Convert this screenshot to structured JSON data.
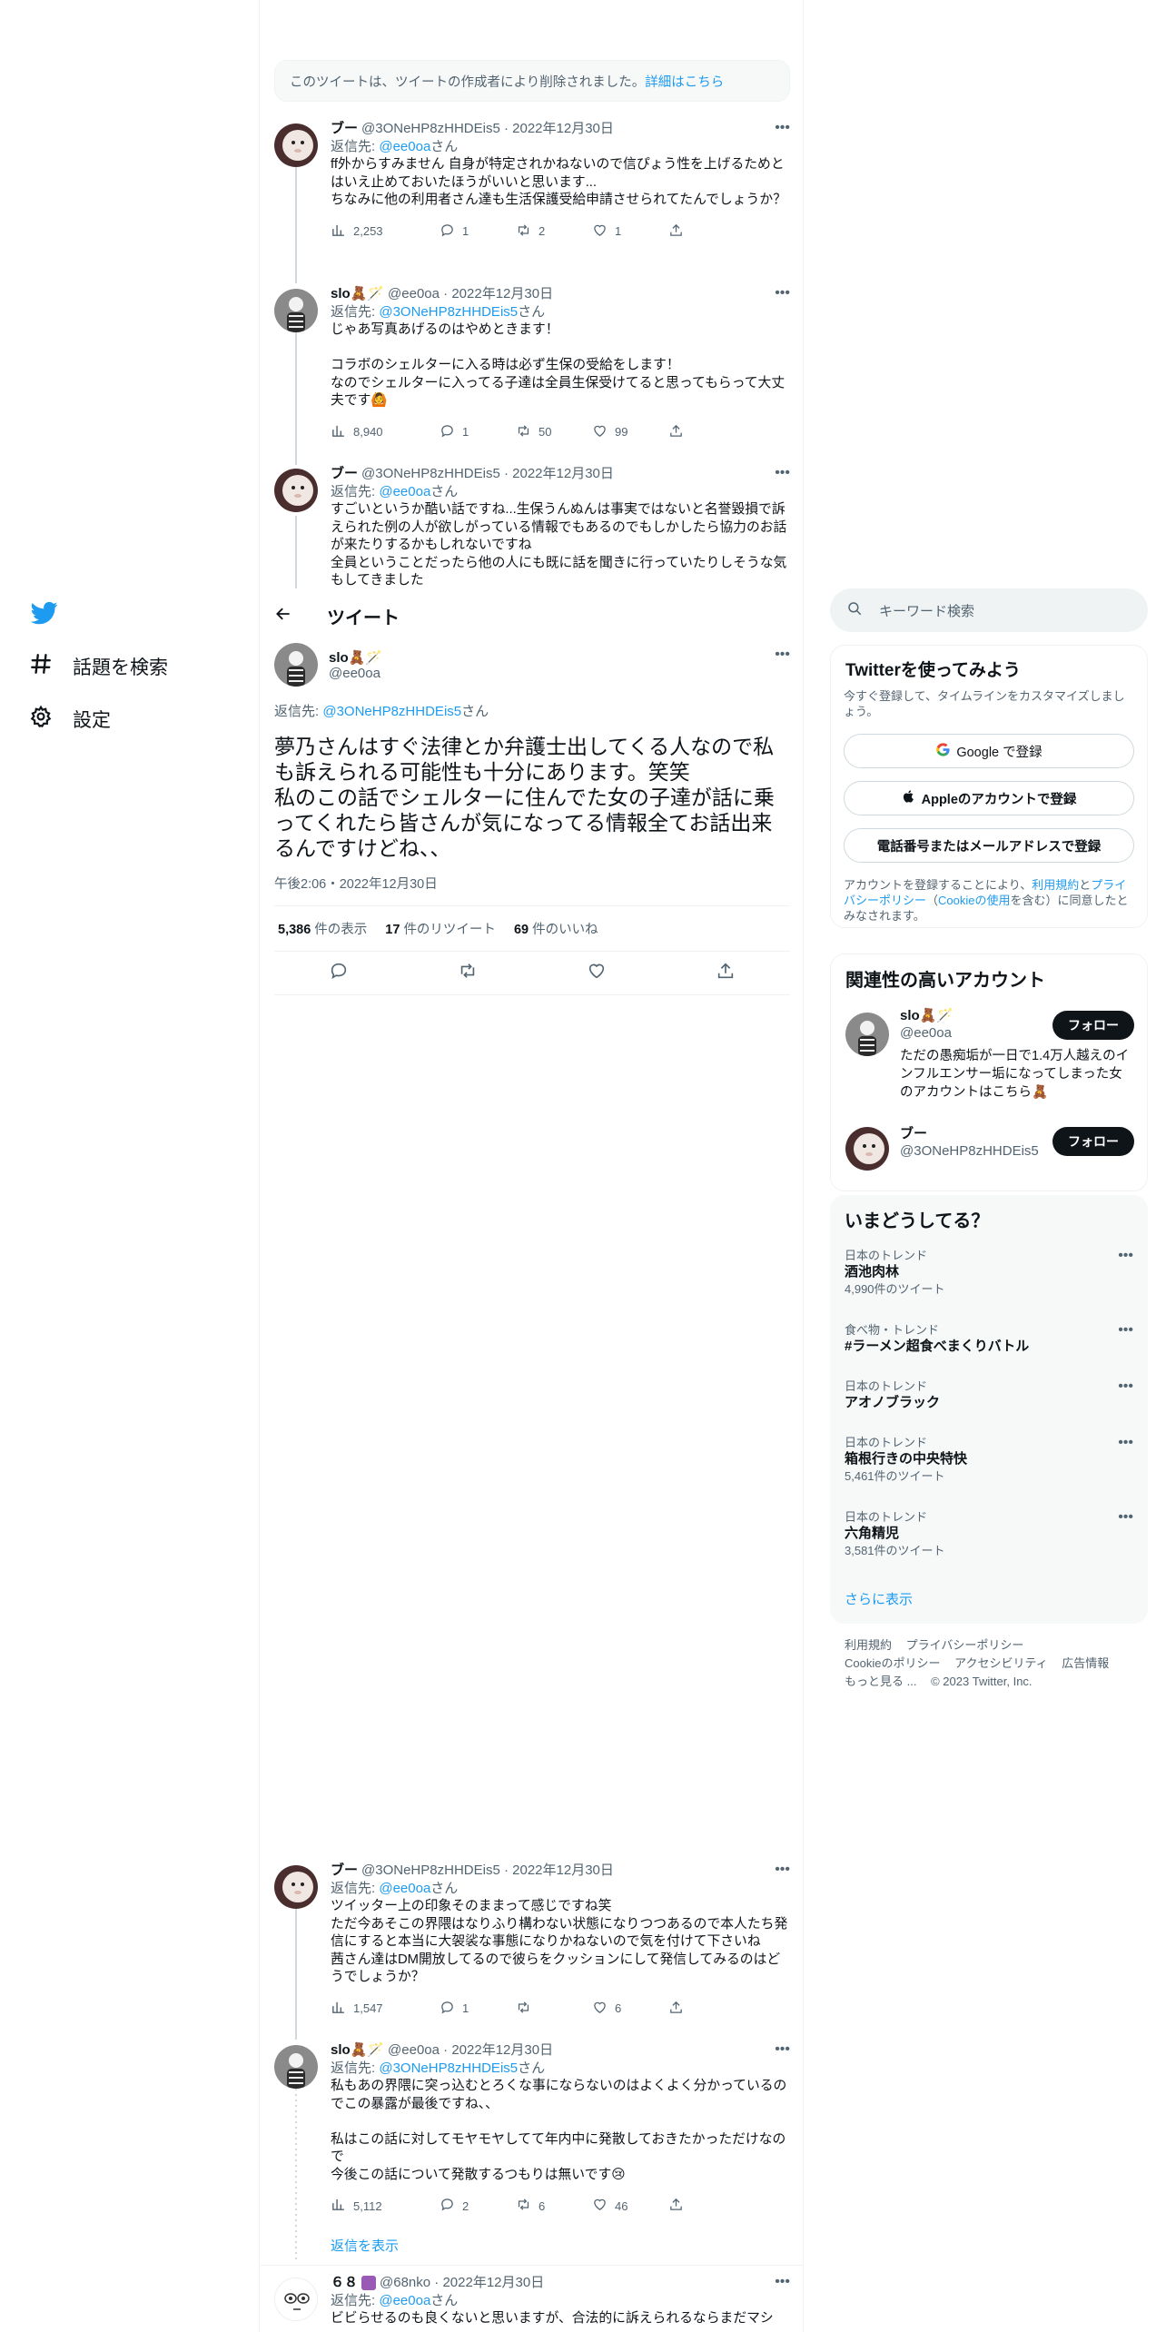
{
  "nav": {
    "explore_label": "話題を検索",
    "settings_label": "設定"
  },
  "deleted_notice": {
    "text": "このツイートは、ツイートの作成者により削除されました。",
    "link": "詳細はこちら"
  },
  "thread_above": [
    {
      "name": "ブー",
      "handle": "@3ONeHP8zHHDEis5",
      "date": "2022年12月30日",
      "reply_prefix": "返信先:",
      "reply_to": "@ee0oa",
      "reply_suffix": "さん",
      "body": "ff外からすみません 自身が特定されかねないので信ぴょう性を上げるためとはいえ止めておいたほうがいいと思います...\nちなみに他の利用者さん達も生活保護受給申請させられてたんでしょうか？",
      "views": "2,253",
      "replies": "1",
      "retweets": "2",
      "likes": "1"
    },
    {
      "name": "slo🧸🪄",
      "handle": "@ee0oa",
      "date": "2022年12月30日",
      "reply_prefix": "返信先:",
      "reply_to": "@3ONeHP8zHHDEis5",
      "reply_suffix": "さん",
      "body": "じゃあ写真あげるのはやめときます！\n\nコラボのシェルターに入る時は必ず生保の受給をします！\nなのでシェルターに入ってる子達は全員生保受けてると思ってもらって大丈夫です🙆",
      "views": "8,940",
      "replies": "1",
      "retweets": "50",
      "likes": "99"
    },
    {
      "name": "ブー",
      "handle": "@3ONeHP8zHHDEis5",
      "date": "2022年12月30日",
      "reply_prefix": "返信先:",
      "reply_to": "@ee0oa",
      "reply_suffix": "さん",
      "body": "すごいというか酷い話ですね...生保うんぬんは事実ではないと名誉毀損で訴えられた例の人が欲しがっている情報でもあるのでもしかしたら協力のお話が来たりするかもしれないですね\n全員ということだったら他の人にも既に話を聞きに行っていたりしそうな気もしてきました"
    }
  ],
  "focus": {
    "header_title": "ツイート",
    "name": "slo🧸🪄",
    "handle": "@ee0oa",
    "reply_prefix": "返信先:",
    "reply_to": "@3ONeHP8zHHDEis5",
    "reply_suffix": "さん",
    "body": "夢乃さんはすぐ法律とか弁護士出してくる人なので私も訴えられる可能性も十分にあります。笑笑\n私のこの話でシェルターに住んでた女の子達が話に乗ってくれたら皆さんが気になってる情報全てお話出来るんですけどね、、",
    "timestamp": "午後2:06・2022年12月30日",
    "views_num": "5,386",
    "views_label": "件の表示",
    "retweets_num": "17",
    "retweets_label": "件のリツイート",
    "likes_num": "69",
    "likes_label": "件のいいね"
  },
  "replies": [
    {
      "name": "ブー",
      "handle": "@3ONeHP8zHHDEis5",
      "date": "2022年12月30日",
      "reply_prefix": "返信先:",
      "reply_to": "@ee0oa",
      "reply_suffix": "さん",
      "body": "ツイッター上の印象そのままって感じですね笑\nただ今あそこの界隈はなりふり構わない状態になりつつあるので本人たち発信にすると本当に大袈裟な事態になりかねないので気を付けて下さいね\n茜さん達はDM開放してるので彼らをクッションにして発信してみるのはどうでしょうか？",
      "views": "1,547",
      "replies": "1",
      "retweets": "",
      "likes": "6"
    },
    {
      "name": "slo🧸🪄",
      "handle": "@ee0oa",
      "date": "2022年12月30日",
      "reply_prefix": "返信先:",
      "reply_to": "@3ONeHP8zHHDEis5",
      "reply_suffix": "さん",
      "body": "私もあの界隈に突っ込むとろくな事にならないのはよくよく分かっているのでこの暴露が最後ですね、、\n\n私はこの話に対してモヤモヤしてて年内中に発散しておきたかっただけなので\n今後この話について発散するつもりは無いです😢",
      "views": "5,112",
      "replies": "2",
      "retweets": "6",
      "likes": "46"
    }
  ],
  "show_replies_label": "返信を表示",
  "last_reply": {
    "name": "６８",
    "handle": "@68nko",
    "date": "2022年12月30日",
    "reply_prefix": "返信先:",
    "reply_to": "@ee0oa",
    "reply_suffix": "さん",
    "body": "ビビらせるのも良くないと思いますが、合法的に訴えられるならまだマシ"
  },
  "right": {
    "search_placeholder": "キーワード検索",
    "signup": {
      "title": "Twitterを使ってみよう",
      "subtitle": "今すぐ登録して、タイムラインをカスタマイズしましょう。",
      "google": "Google で登録",
      "apple": "Appleのアカウントで登録",
      "phone": "電話番号またはメールアドレスで登録",
      "terms_pre": "アカウントを登録することにより、",
      "terms_link1": "利用規約",
      "terms_and": "と",
      "terms_link2": "プライバシーポリシー",
      "terms_paren_open": "（",
      "terms_link3": "Cookieの使用",
      "terms_post": "を含む）に同意したとみなされます。"
    },
    "related": {
      "title": "関連性の高いアカウント",
      "accounts": [
        {
          "name": "slo🧸🪄",
          "handle": "@ee0oa",
          "bio": "ただの愚痴垢が一日で1.4万人越えのインフルエンサー垢になってしまった女のアカウントはこちら🧸",
          "follow": "フォロー"
        },
        {
          "name": "ブー",
          "handle": "@3ONeHP8zHHDEis5",
          "bio": "",
          "follow": "フォロー"
        }
      ]
    },
    "trends": {
      "title": "いまどうしてる？",
      "items": [
        {
          "category": "日本のトレンド",
          "name": "酒池肉林",
          "count": "4,990件のツイート"
        },
        {
          "category": "食べ物・トレンド",
          "name": "#ラーメン超食べまくりバトル",
          "count": ""
        },
        {
          "category": "日本のトレンド",
          "name": "アオノブラック",
          "count": ""
        },
        {
          "category": "日本のトレンド",
          "name": "箱根行きの中央特快",
          "count": "5,461件のツイート"
        },
        {
          "category": "日本のトレンド",
          "name": "六角精児",
          "count": "3,581件のツイート"
        }
      ],
      "show_more": "さらに表示"
    },
    "footer": [
      "利用規約",
      "プライバシーポリシー",
      "Cookieのポリシー",
      "アクセシビリティ",
      "広告情報",
      "もっと見る ...",
      "© 2023 Twitter, Inc."
    ]
  },
  "colors": {
    "accent": "#1d9bf0",
    "text": "#0f1419",
    "muted": "#536471"
  }
}
